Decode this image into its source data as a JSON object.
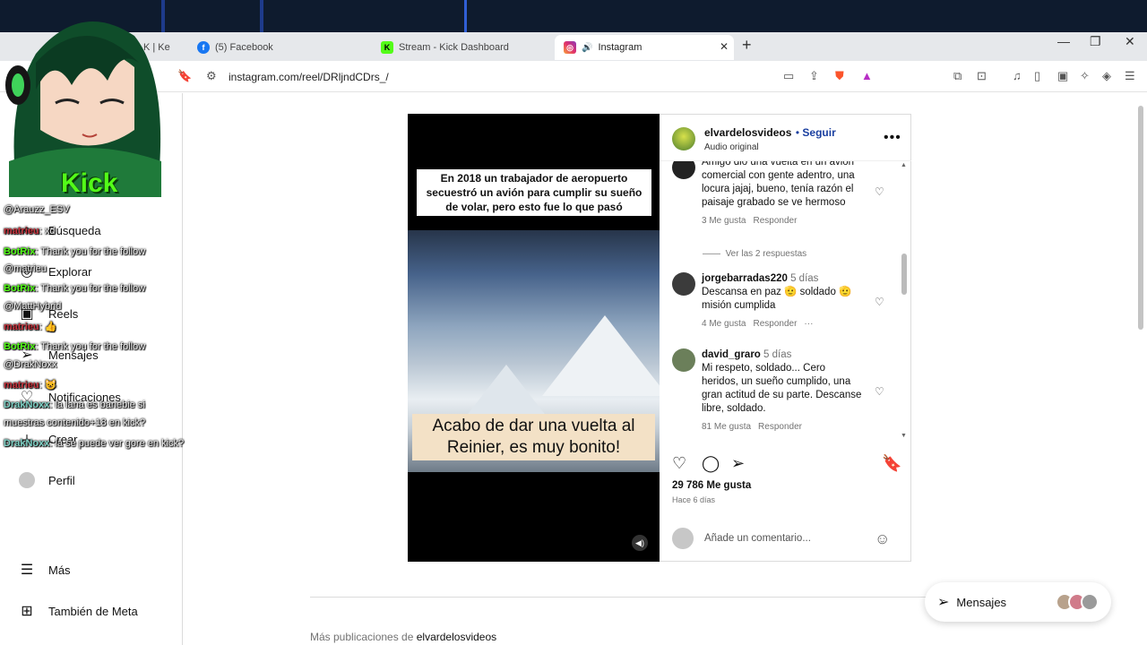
{
  "browser": {
    "tabs": [
      {
        "label": "",
        "icon": "kick-icon"
      },
      {
        "label": "K | Ke",
        "icon": "kick-icon"
      },
      {
        "label": "(5) Facebook",
        "icon": "facebook-icon"
      },
      {
        "label": "Stream - Kick Dashboard",
        "icon": "kick-icon"
      },
      {
        "label": "Instagram",
        "icon": "instagram-icon",
        "active": true
      }
    ],
    "url": "instagram.com/reel/DRljndCDrs_/"
  },
  "sidebar": {
    "items": [
      {
        "label": "Búsqueda",
        "icon": "search-icon"
      },
      {
        "label": "Explorar",
        "icon": "compass-icon"
      },
      {
        "label": "Reels",
        "icon": "reels-icon"
      },
      {
        "label": "Mensajes",
        "icon": "send-icon"
      },
      {
        "label": "Notificaciones",
        "icon": "heart-icon"
      },
      {
        "label": "Crear",
        "icon": "plus-icon"
      },
      {
        "label": "Perfil",
        "icon": "profile-icon"
      },
      {
        "label": "Más",
        "icon": "menu-icon"
      },
      {
        "label": "También de Meta",
        "icon": "meta-grid-icon"
      }
    ]
  },
  "video": {
    "caption_top": "En 2018 un trabajador de aeropuerto secuestró un avión para cumplir su sueño de volar, pero esto fue lo que pasó",
    "caption_bottom": "Acabo de dar una vuelta al Reinier, es muy bonito!"
  },
  "post": {
    "username": "elvardelosvideos",
    "follow": "Seguir",
    "audio": "Audio original",
    "comments": [
      {
        "user": "",
        "date": "",
        "text": "Amigo dió una vuelta en un avión comercial con gente adentro, una locura jajaj, bueno, tenía razón el paisaje grabado se ve hermoso",
        "likes": "3 Me gusta",
        "reply": "Responder"
      },
      {
        "user": "jorgebarradas220",
        "date": "5 días",
        "text": "Descansa en paz 🫡 soldado 🫡 misión cumplida",
        "likes": "4 Me gusta",
        "reply": "Responder"
      },
      {
        "user": "david_graro",
        "date": "5 días",
        "text": "Mi respeto, soldado... Cero heridos, un sueño cumplido, una gran actitud de su parte. Descanse libre, soldado.",
        "likes": "81 Me gusta",
        "reply": "Responder"
      }
    ],
    "view_replies": "Ver las 2 respuestas",
    "like_count": "29 786 Me gusta",
    "posted": "Hace 6 días",
    "add_comment_placeholder": "Añade un comentario..."
  },
  "footer": {
    "more_from_prefix": "Más publicaciones de",
    "more_from_user": "elvardelosvideos"
  },
  "messages_button": {
    "label": "Mensajes"
  },
  "stream_overlay": {
    "logo": "Kick",
    "chat": [
      {
        "text": "@Arauzz_ESV"
      },
      {
        "user": "matrieu",
        "text": ": xd"
      },
      {
        "user": "BotRix",
        "text": ": Thank you for the follow"
      },
      {
        "text": "@matrieu"
      },
      {
        "user": "BotRix",
        "text": ": Thank you for the follow"
      },
      {
        "text": "@MattHybrid"
      },
      {
        "user": "matrieu",
        "text": ": 👍"
      },
      {
        "user": "BotRix",
        "text": ": Thank you for the follow"
      },
      {
        "text": "@DrakNoxx"
      },
      {
        "user": "matrieu",
        "text": ": 😺"
      },
      {
        "user": "DrakNoxx",
        "text": ": la lana es banebie si"
      },
      {
        "text": "muestras contenido+18 en kick?"
      },
      {
        "user": "DrakNoxx",
        "text": ": la se puede ver gore en kick?"
      }
    ]
  },
  "colors": {
    "kick_green": "#53fc18",
    "follow_blue": "#1a3fa0",
    "caption_bg": "#f3e1c6"
  }
}
